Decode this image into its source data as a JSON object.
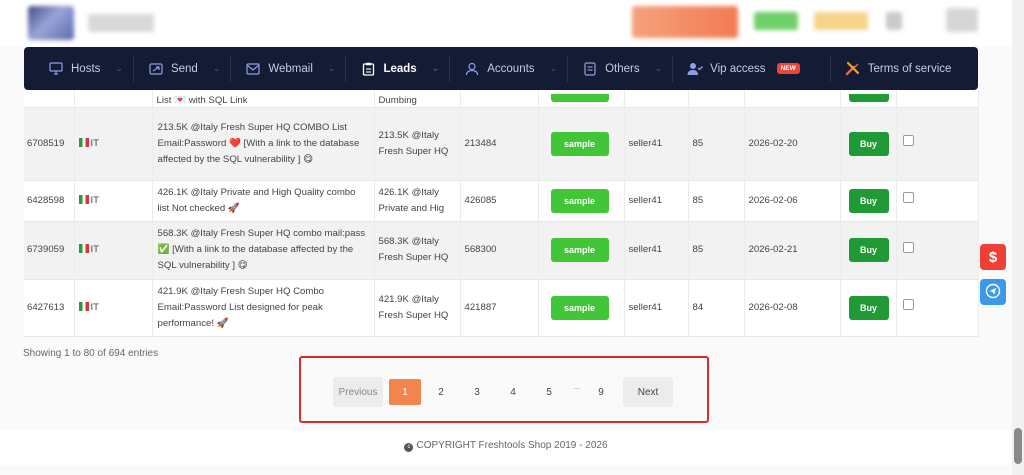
{
  "nav": {
    "items": [
      {
        "label": "Hosts",
        "icon": "monitor-icon"
      },
      {
        "label": "Send",
        "icon": "send-icon"
      },
      {
        "label": "Webmail",
        "icon": "mail-icon"
      },
      {
        "label": "Leads",
        "icon": "clipboard-icon",
        "active": true
      },
      {
        "label": "Accounts",
        "icon": "user-icon"
      },
      {
        "label": "Others",
        "icon": "list-icon"
      },
      {
        "label": "Vip access",
        "icon": "user-check-icon",
        "badge": "NEW"
      },
      {
        "label": "Terms of service",
        "icon": "tools-icon"
      }
    ]
  },
  "table": {
    "partial_row": {
      "description": "List 💌 with SQL Link",
      "title": "Dumbing"
    },
    "rows": [
      {
        "id": "6708519",
        "country": "IT",
        "description": "213.5K @Italy Fresh Super HQ COMBO List Email:Password ❤️ [With a link to the database affected by the SQL vulnerability ] 😋",
        "title": "213.5K @Italy Fresh Super HQ",
        "count": "213484",
        "sample": "sample",
        "seller": "seller41",
        "price": "85",
        "date": "2026-02-20",
        "buy": "Buy"
      },
      {
        "id": "6428598",
        "country": "IT",
        "description": "426.1K @Italy Private and High Quality combo list Not checked 🚀",
        "title": "426.1K @Italy Private and Hig",
        "count": "426085",
        "sample": "sample",
        "seller": "seller41",
        "price": "85",
        "date": "2026-02-06",
        "buy": "Buy"
      },
      {
        "id": "6739059",
        "country": "IT",
        "description": "568.3K @Italy Fresh Super HQ combo mail:pass ✅ [With a link to the database affected by the SQL vulnerability ] 😋",
        "title": "568.3K @Italy Fresh Super HQ",
        "count": "568300",
        "sample": "sample",
        "seller": "seller41",
        "price": "85",
        "date": "2026-02-21",
        "buy": "Buy"
      },
      {
        "id": "6427613",
        "country": "IT",
        "description": "421.9K @Italy Fresh Super HQ Combo Email:Password List designed for peak performance! 🚀",
        "title": "421.9K @Italy Fresh Super HQ",
        "count": "421887",
        "sample": "sample",
        "seller": "seller41",
        "price": "84",
        "date": "2026-02-08",
        "buy": "Buy"
      }
    ]
  },
  "info": "Showing 1 to 80 of 694 entries",
  "pagination": {
    "previous": "Previous",
    "pages": [
      "1",
      "2",
      "3",
      "4",
      "5"
    ],
    "ellipsis": "...",
    "last": "9",
    "next": "Next",
    "current": "1"
  },
  "footer": {
    "text": "COPYRIGHT Freshtools Shop 2019 - 2026"
  },
  "floating": {
    "dollar": "$"
  },
  "colors": {
    "nav_bg": "#141b34",
    "sample_green": "#42c536",
    "buy_green": "#1f9a35",
    "active_page": "#f2854b",
    "highlight_border": "#d82c2c"
  }
}
